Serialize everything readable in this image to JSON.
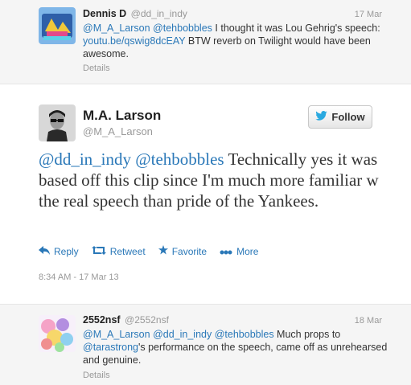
{
  "tweets": {
    "top": {
      "fullname": "Dennis D",
      "handle": "@dd_in_indy",
      "date": "17 Mar",
      "text_parts": {
        "mention1": "@M_A_Larson",
        "mention2": "@tehbobbles",
        "text1": " I thought it was Lou Gehrig's speech: ",
        "link": "youtu.be/qswig8dcEAY",
        "text2": " BTW reverb on Twilight would have been awesome."
      },
      "details": "Details"
    },
    "main": {
      "fullname": "M.A. Larson",
      "handle": "@M_A_Larson",
      "follow_label": "Follow",
      "text_parts": {
        "mention1": "@dd_in_indy",
        "mention2": "@tehbobbles",
        "text": " Technically yes it was based off this clip since I'm much more familiar w the real speech than pride of the Yankees."
      },
      "actions": {
        "reply": "Reply",
        "retweet": "Retweet",
        "favorite": "Favorite",
        "more": "More"
      },
      "timestamp": "8:34 AM - 17 Mar 13"
    },
    "bottom": {
      "fullname": "2552nsf",
      "handle": "@2552nsf",
      "date": "18 Mar",
      "text_parts": {
        "mention1": "@M_A_Larson",
        "mention2": "@dd_in_indy",
        "mention3": "@tehbobbles",
        "text1": " Much props to ",
        "mention4": "@tarastrong",
        "text2": "'s performance on the speech, came off as unrehearsed and genuine."
      },
      "details": "Details"
    }
  },
  "colors": {
    "link": "#2a78b8",
    "twitter_bird": "#2aa9e0"
  }
}
